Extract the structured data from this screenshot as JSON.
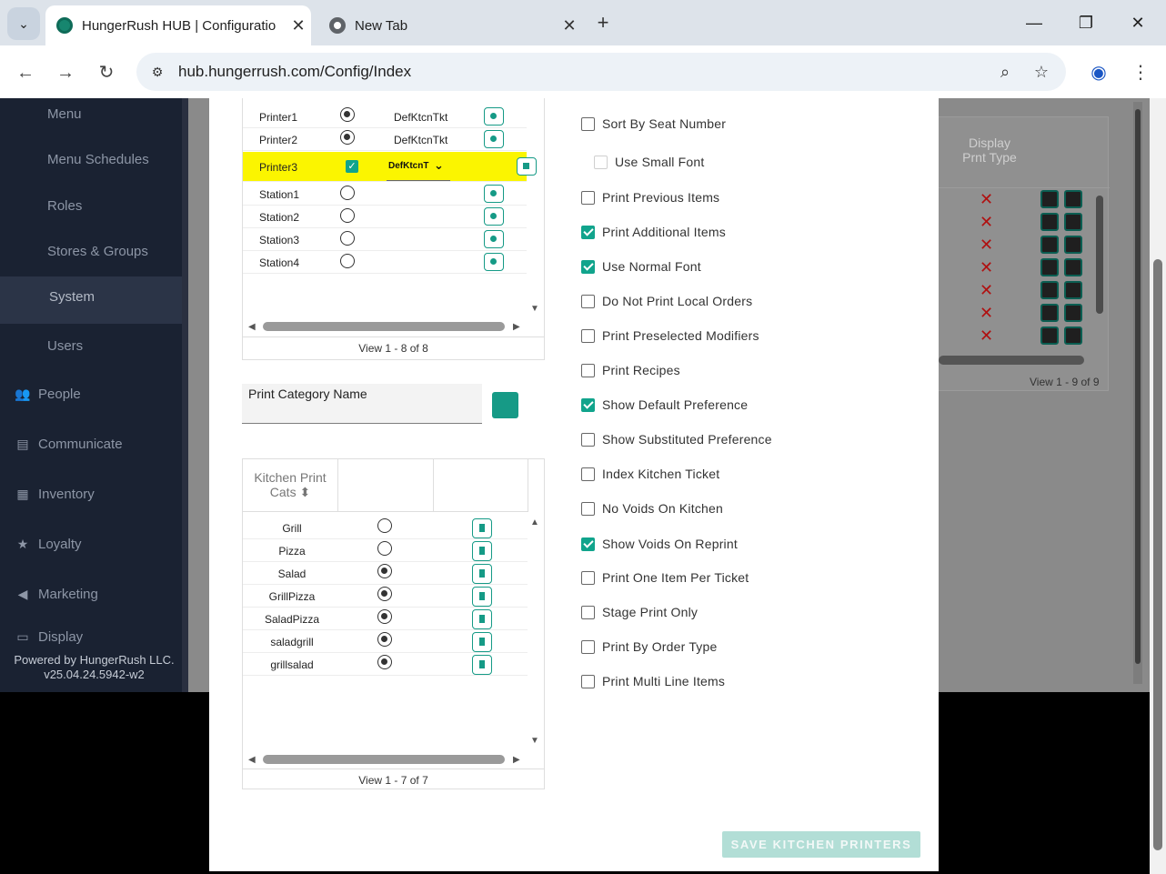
{
  "browser": {
    "tabs": [
      {
        "title": "HungerRush HUB | Configuratio",
        "active": true
      },
      {
        "title": "New Tab",
        "active": false
      }
    ],
    "url": "hub.hungerrush.com/Config/Index"
  },
  "sidebar": {
    "subitems": [
      "Menu",
      "Menu Schedules",
      "Roles",
      "Stores & Groups",
      "System",
      "Users"
    ],
    "selected": "System",
    "main_items": [
      {
        "label": "People",
        "icon": "people-icon"
      },
      {
        "label": "Communicate",
        "icon": "chat-icon"
      },
      {
        "label": "Inventory",
        "icon": "clipboard-icon"
      },
      {
        "label": "Loyalty",
        "icon": "star-icon"
      },
      {
        "label": "Marketing",
        "icon": "megaphone-icon"
      },
      {
        "label": "Display",
        "icon": "display-icon"
      }
    ],
    "powered_by": "Powered by HungerRush LLC.",
    "version": "v25.04.24.5942-w2"
  },
  "background_grid": {
    "header": "Display Prnt Type",
    "view": "View 1 - 9 of 9"
  },
  "printers_grid": {
    "rows": [
      {
        "name": "Printer1",
        "selected": true,
        "value": "DefKtcnTkt"
      },
      {
        "name": "Printer2",
        "selected": true,
        "value": "DefKtcnTkt"
      },
      {
        "name": "Printer3",
        "editing": true,
        "checked": true,
        "value": "DefKtcnT"
      },
      {
        "name": "Station1",
        "selected": false,
        "value": ""
      },
      {
        "name": "Station2",
        "selected": false,
        "value": ""
      },
      {
        "name": "Station3",
        "selected": false,
        "value": ""
      },
      {
        "name": "Station4",
        "selected": false,
        "value": ""
      }
    ],
    "view": "View 1 - 8 of 8"
  },
  "print_category": {
    "label": "Print Category Name",
    "value": ""
  },
  "kitchen_cats": {
    "header": "Kitchen Print Cats",
    "rows": [
      {
        "name": "Grill",
        "selected": false
      },
      {
        "name": "Pizza",
        "selected": false
      },
      {
        "name": "Salad",
        "selected": true
      },
      {
        "name": "GrillPizza",
        "selected": true
      },
      {
        "name": "SaladPizza",
        "selected": true
      },
      {
        "name": "saladgrill",
        "selected": true
      },
      {
        "name": "grillsalad",
        "selected": true
      }
    ],
    "view": "View 1 - 7 of 7"
  },
  "options": [
    {
      "label": "Sort By Seat Number",
      "checked": false
    },
    {
      "label": "Use Small Font",
      "checked": false,
      "indent": true,
      "disabled": true
    },
    {
      "label": "Print Previous Items",
      "checked": false
    },
    {
      "label": "Print Additional Items",
      "checked": true
    },
    {
      "label": "Use Normal Font",
      "checked": true
    },
    {
      "label": "Do Not Print Local Orders",
      "checked": false
    },
    {
      "label": "Print Preselected Modifiers",
      "checked": false
    },
    {
      "label": "Print Recipes",
      "checked": false
    },
    {
      "label": "Show Default Preference",
      "checked": true
    },
    {
      "label": "Show Substituted Preference",
      "checked": false
    },
    {
      "label": "Index Kitchen Ticket",
      "checked": false
    },
    {
      "label": "No Voids On Kitchen",
      "checked": false
    },
    {
      "label": "Show Voids On Reprint",
      "checked": true
    },
    {
      "label": "Print One Item Per Ticket",
      "checked": false
    },
    {
      "label": "Stage Print Only",
      "checked": false
    },
    {
      "label": "Print By Order Type",
      "checked": false
    },
    {
      "label": "Print Multi Line Items",
      "checked": false
    }
  ],
  "save_button": "SAVE KITCHEN PRINTERS",
  "colors": {
    "accent": "#11a48c",
    "highlight": "#fbf500",
    "sidebar": "#1a2232"
  }
}
